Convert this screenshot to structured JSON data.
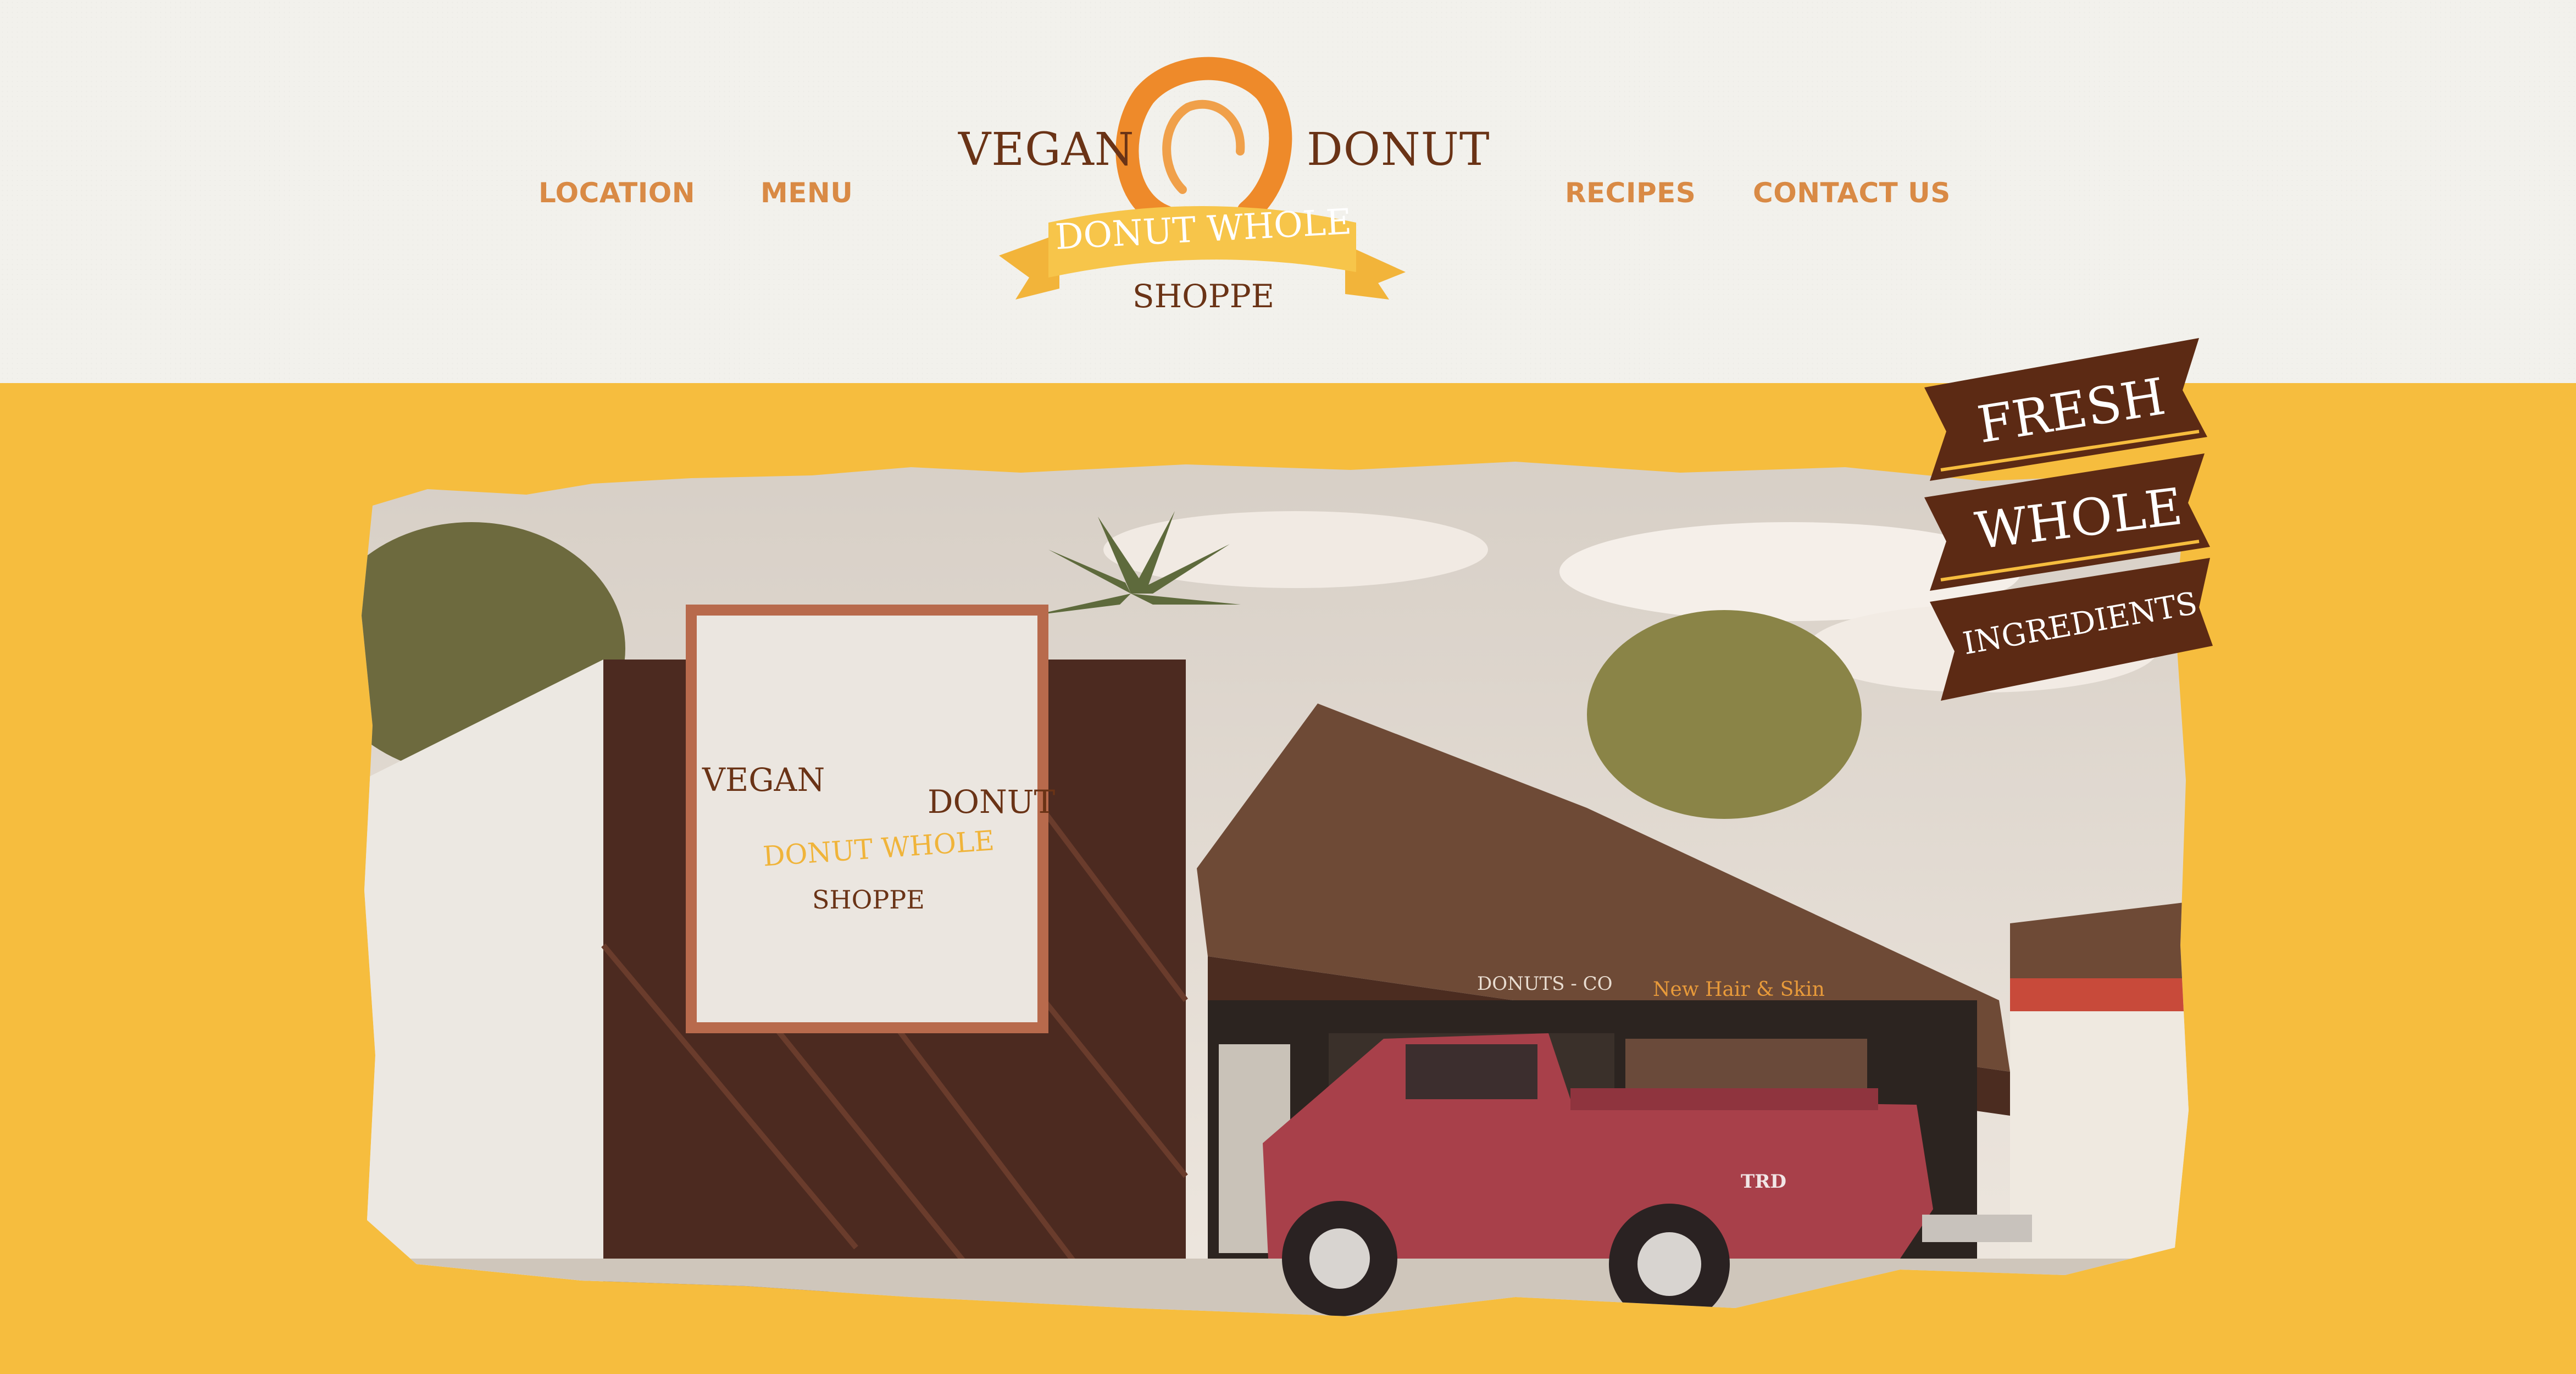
{
  "nav": {
    "location": "LOCATION",
    "menu": "MENU",
    "recipes": "RECIPES",
    "contact": "CONTACT US"
  },
  "logo": {
    "left_word": "VEGAN",
    "right_word": "DONUT",
    "ribbon": "DONUT WHOLE",
    "bottom": "SHOPPE"
  },
  "banner": {
    "line1": "FRESH",
    "line2": "WHOLE",
    "line3": "INGREDIENTS"
  },
  "photo": {
    "store_sign_left": "VEGAN",
    "store_sign_right": "DONUT",
    "store_sign_ribbon": "DONUT WHOLE",
    "store_sign_bottom": "SHOPPE",
    "window_text_1": "DONUTS - CO",
    "window_text_2": "New Hair & Skin",
    "truck_badge": "TRD"
  },
  "colors": {
    "background_yellow": "#f6bd3e",
    "header_bg": "#f2f1ec",
    "nav_orange": "#d98a45",
    "brown": "#5c2a14",
    "logo_orange": "#ee8a2a",
    "ribbon_yellow": "#f7c54a"
  },
  "icons": {
    "logo": "donut-ring-logo",
    "banner": "ribbon-banner"
  }
}
